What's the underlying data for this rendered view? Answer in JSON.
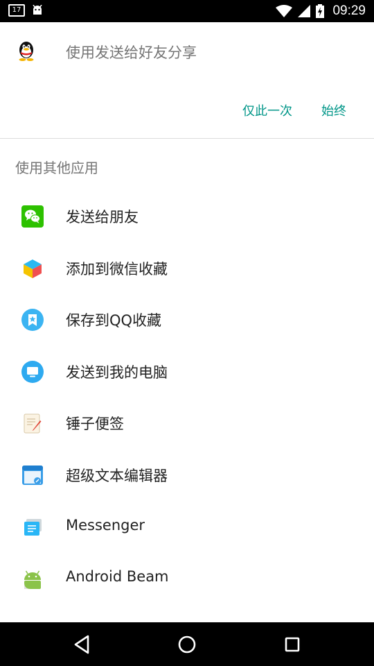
{
  "status_bar": {
    "calendar_badge": "17",
    "time": "09:29"
  },
  "share_target": {
    "icon": "qq-penguin-icon",
    "title": "使用发送给好友分享",
    "once_label": "仅此一次",
    "always_label": "始终"
  },
  "other_apps": {
    "header": "使用其他应用",
    "items": [
      {
        "label": "发送给朋友",
        "icon": "wechat-icon"
      },
      {
        "label": "添加到微信收藏",
        "icon": "wechat-favorites-cube-icon"
      },
      {
        "label": "保存到QQ收藏",
        "icon": "qq-favorites-star-icon"
      },
      {
        "label": "发送到我的电脑",
        "icon": "computer-monitor-icon"
      },
      {
        "label": "锤子便签",
        "icon": "notepad-icon"
      },
      {
        "label": "超级文本编辑器",
        "icon": "text-editor-icon"
      },
      {
        "label": "Messenger",
        "icon": "messenger-icon"
      },
      {
        "label": "Android Beam",
        "icon": "android-icon"
      }
    ]
  },
  "nav_bar": {
    "back": "back-triangle-icon",
    "home": "home-circle-icon",
    "recents": "recents-square-icon"
  },
  "colors": {
    "accent": "#009688",
    "primary_text": "#212121",
    "secondary_text": "#757575",
    "divider": "#dcdcdc",
    "system_bar": "#000000"
  }
}
